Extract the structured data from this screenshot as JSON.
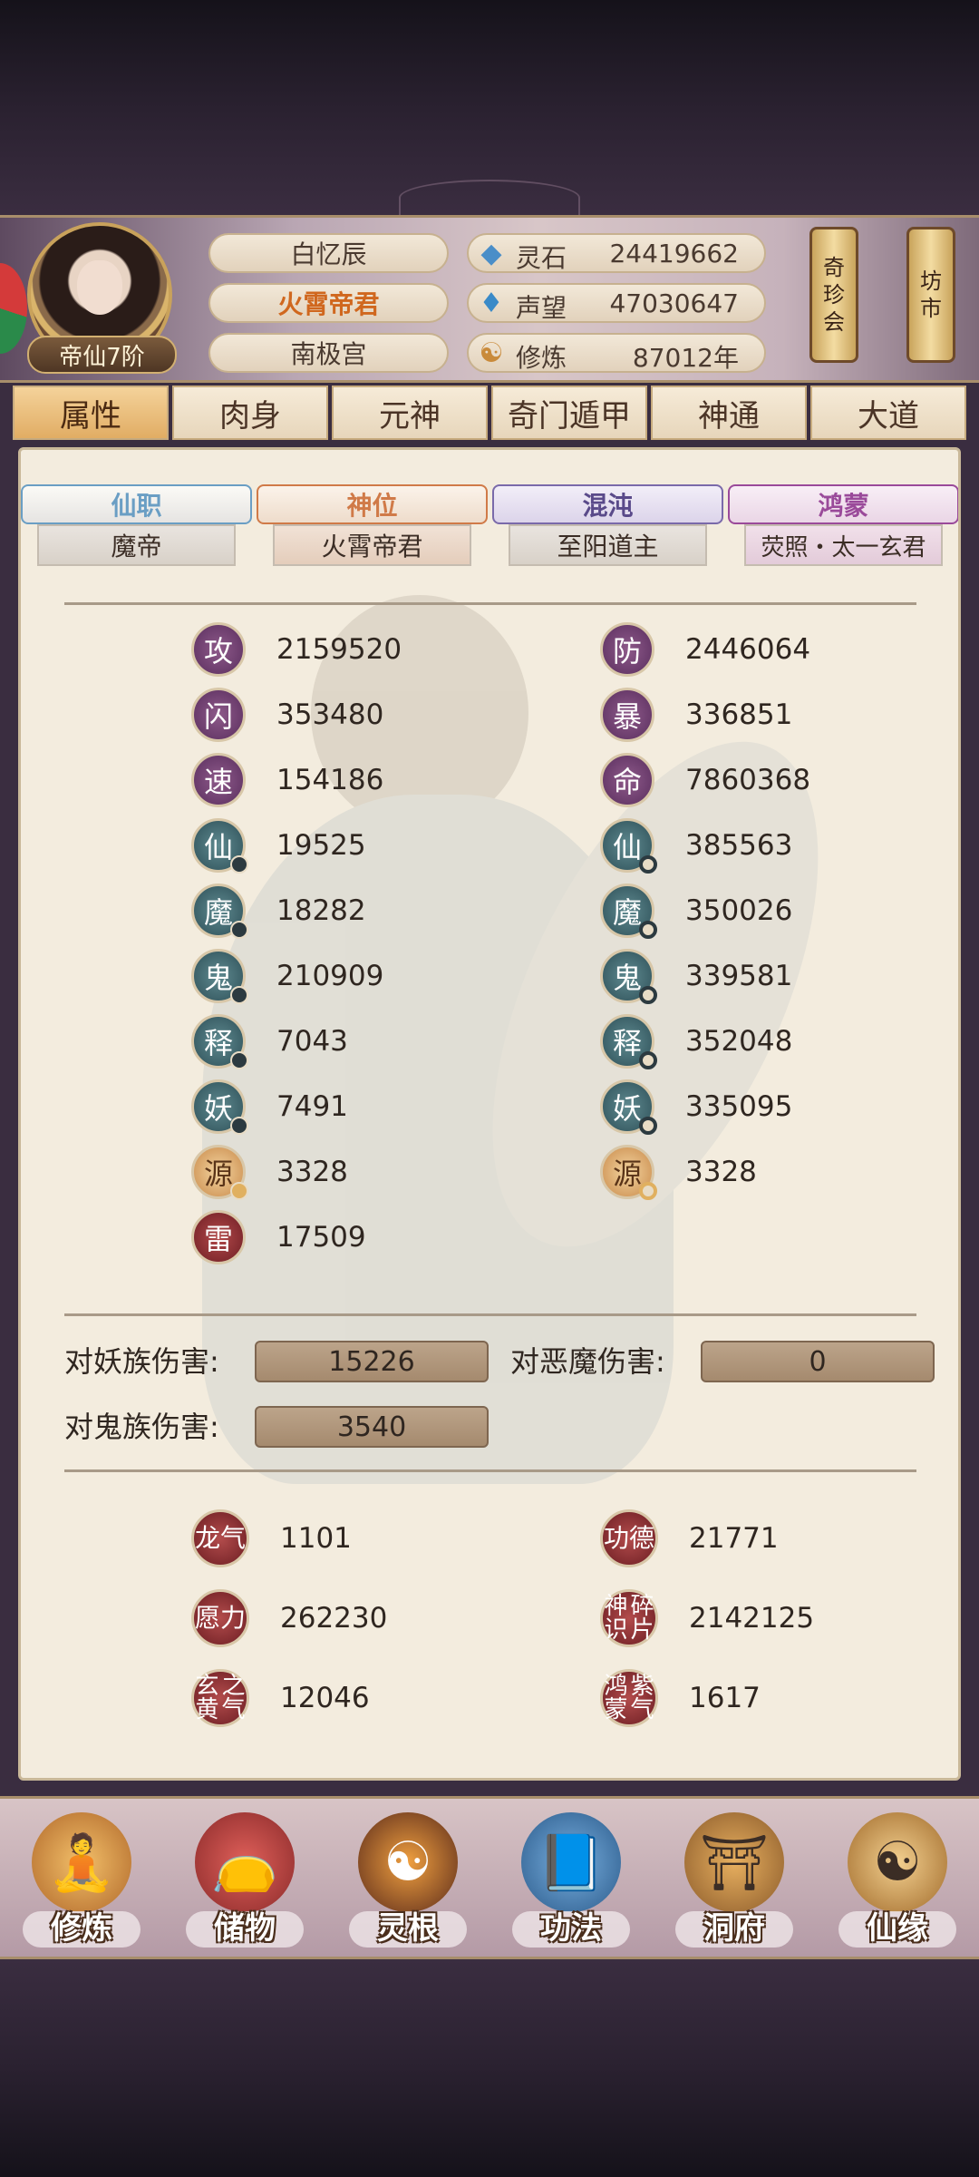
{
  "header": {
    "rank": "帝仙7阶",
    "names": [
      "白忆辰",
      "火霄帝君",
      "南极宫"
    ],
    "resources": [
      {
        "icon": "spirit-stone-icon",
        "label": "灵石",
        "value": "24419662"
      },
      {
        "icon": "reputation-icon",
        "label": "声望",
        "value": "47030647"
      },
      {
        "icon": "cultivation-icon",
        "label": "修炼",
        "value": "87012年"
      }
    ],
    "shop_buttons": [
      {
        "lines": [
          "奇",
          "珍",
          "会"
        ]
      },
      {
        "lines": [
          "坊",
          "市"
        ]
      }
    ]
  },
  "tabs": [
    {
      "label": "属性",
      "active": true
    },
    {
      "label": "肉身",
      "active": false
    },
    {
      "label": "元神",
      "active": false
    },
    {
      "label": "奇门遁甲",
      "active": false
    },
    {
      "label": "神通",
      "active": false
    },
    {
      "label": "大道",
      "active": false
    }
  ],
  "banners": [
    {
      "title": "仙职",
      "value": "魔帝",
      "color": "#6a9ec4"
    },
    {
      "title": "神位",
      "value": "火霄帝君",
      "color": "#d07a48"
    },
    {
      "title": "混沌",
      "value": "至阳道主",
      "color": "#6a5a9a"
    },
    {
      "title": "鸿蒙",
      "value": "荧照・太一玄君",
      "color": "#9a4a9a"
    }
  ],
  "stats_left": [
    {
      "glyph": "攻",
      "value": "2159520",
      "style": "purple",
      "badge": ""
    },
    {
      "glyph": "闪",
      "value": "353480",
      "style": "purple",
      "badge": ""
    },
    {
      "glyph": "速",
      "value": "154186",
      "style": "purple",
      "badge": ""
    },
    {
      "glyph": "仙",
      "value": "19525",
      "style": "teal",
      "badge": "dot"
    },
    {
      "glyph": "魔",
      "value": "18282",
      "style": "teal",
      "badge": "dot"
    },
    {
      "glyph": "鬼",
      "value": "210909",
      "style": "teal",
      "badge": "dot"
    },
    {
      "glyph": "释",
      "value": "7043",
      "style": "teal",
      "badge": "dot"
    },
    {
      "glyph": "妖",
      "value": "7491",
      "style": "teal",
      "badge": "dot"
    },
    {
      "glyph": "源",
      "value": "3328",
      "style": "gold",
      "badge": "dot"
    },
    {
      "glyph": "雷",
      "value": "17509",
      "style": "red",
      "badge": ""
    }
  ],
  "stats_right": [
    {
      "glyph": "防",
      "value": "2446064",
      "style": "purple",
      "badge": ""
    },
    {
      "glyph": "暴",
      "value": "336851",
      "style": "purple",
      "badge": ""
    },
    {
      "glyph": "命",
      "value": "7860368",
      "style": "purple",
      "badge": ""
    },
    {
      "glyph": "仙",
      "value": "385563",
      "style": "teal",
      "badge": "ring"
    },
    {
      "glyph": "魔",
      "value": "350026",
      "style": "teal",
      "badge": "ring"
    },
    {
      "glyph": "鬼",
      "value": "339581",
      "style": "teal",
      "badge": "ring"
    },
    {
      "glyph": "释",
      "value": "352048",
      "style": "teal",
      "badge": "ring"
    },
    {
      "glyph": "妖",
      "value": "335095",
      "style": "teal",
      "badge": "ring"
    },
    {
      "glyph": "源",
      "value": "3328",
      "style": "gold",
      "badge": "ring"
    }
  ],
  "damage": [
    {
      "label": "对妖族伤害:",
      "value": "15226"
    },
    {
      "label": "对恶魔伤害:",
      "value": "0"
    },
    {
      "label": "对鬼族伤害:",
      "value": "3540"
    }
  ],
  "specials": [
    {
      "glyph": "龙气",
      "value": "1101"
    },
    {
      "glyph": "功德",
      "value": "21771"
    },
    {
      "glyph": "愿力",
      "value": "262230"
    },
    {
      "glyph": "神识碎片",
      "glyph_lines": [
        "神识",
        "碎片"
      ],
      "value": "2142125"
    },
    {
      "glyph": "玄黄之气",
      "glyph_lines": [
        "玄黄",
        "之气"
      ],
      "value": "12046"
    },
    {
      "glyph": "鸿蒙紫气",
      "glyph_lines": [
        "鸿蒙",
        "紫气"
      ],
      "value": "1617"
    }
  ],
  "nav": [
    {
      "label": "修炼",
      "icon": "monk-icon"
    },
    {
      "label": "储物",
      "icon": "bag-icon"
    },
    {
      "label": "灵根",
      "icon": "spirit-root-icon"
    },
    {
      "label": "功法",
      "icon": "book-icon"
    },
    {
      "label": "洞府",
      "icon": "house-icon"
    },
    {
      "label": "仙缘",
      "icon": "gourd-icon"
    }
  ]
}
